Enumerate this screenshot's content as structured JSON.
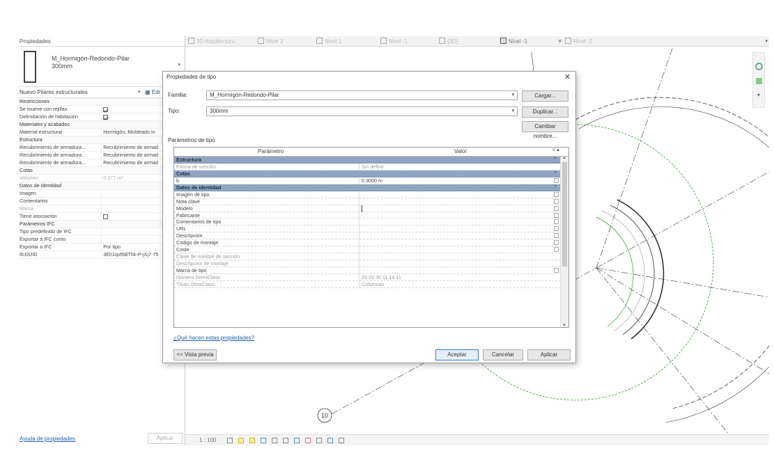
{
  "properties_palette": {
    "title": "Propiedades",
    "type_name": "M_Hormigón-Redondo-Pilar",
    "type_size": "300mm",
    "selector_label": "Nuevo Pilares estructurales",
    "edit_type_label": "Edi",
    "rows": [
      {
        "label": "Restricciones",
        "value": "",
        "kind": "group"
      },
      {
        "label": "Se mueve con rejillas",
        "value": "",
        "kind": "check-on"
      },
      {
        "label": "Delimitación de habitación",
        "value": "",
        "kind": "check-on"
      },
      {
        "label": "Materiales y acabados",
        "value": "",
        "kind": "group"
      },
      {
        "label": "Material estructural",
        "value": "Hormigón, Moldeado in",
        "kind": "row"
      },
      {
        "label": "Estructura",
        "value": "",
        "kind": "group"
      },
      {
        "label": "Recubrimiento de armadura...",
        "value": "Recubrimiento de armad",
        "kind": "row"
      },
      {
        "label": "Recubrimiento de armadura...",
        "value": "Recubrimiento de armad",
        "kind": "row"
      },
      {
        "label": "Recubrimiento de armadura...",
        "value": "Recubrimiento de armad",
        "kind": "row"
      },
      {
        "label": "Cotas",
        "value": "",
        "kind": "group"
      },
      {
        "label": "Volumen",
        "value": "0.177 m³",
        "kind": "dim"
      },
      {
        "label": "Datos de identidad",
        "value": "",
        "kind": "group"
      },
      {
        "label": "Imagen",
        "value": "",
        "kind": "row"
      },
      {
        "label": "Comentarios",
        "value": "",
        "kind": "row"
      },
      {
        "label": "Marca",
        "value": "",
        "kind": "dim"
      },
      {
        "label": "Tiene asociación",
        "value": "",
        "kind": "check-off"
      },
      {
        "label": "Parámetros IFC",
        "value": "",
        "kind": "group"
      },
      {
        "label": "Tipo predefinido de IFC",
        "value": "",
        "kind": "row"
      },
      {
        "label": "Exportar a IFC como",
        "value": "",
        "kind": "row"
      },
      {
        "label": "Exportar a IFC",
        "value": "Por tipo",
        "kind": "row"
      },
      {
        "label": "IfcGUID",
        "value": "3Eh1qvt5BThk-P-jXj7-75",
        "kind": "row"
      }
    ],
    "help_link": "Ayuda de propiedades",
    "apply_label": "Aplicar"
  },
  "view_tabs": {
    "tabs": [
      {
        "label": "3D Arquitectura",
        "active": false
      },
      {
        "label": "Nivel 2",
        "active": false
      },
      {
        "label": "Nivel 1",
        "active": false
      },
      {
        "label": "Nivel -1",
        "active": false
      },
      {
        "label": "{3D}",
        "active": false
      },
      {
        "label": "Nivel -1",
        "active": true
      },
      {
        "label": "Nivel -2",
        "active": false
      }
    ],
    "close_glyph": "×"
  },
  "canvas": {
    "grid_bubble_label": "10",
    "nav_glyph": "▾"
  },
  "view_control_bar": {
    "scale": "1 : 100"
  },
  "dialog": {
    "title": "Propiedades de tipo",
    "family_label": "Familia:",
    "family_value": "M_Hormigón-Redondo-Pilar",
    "type_label": "Tipo:",
    "type_value": "300mm",
    "load_button": "Cargar...",
    "duplicate_button": "Duplicar...",
    "rename_button": "Cambiar nombre...",
    "type_params_label": "Parámetros de tipo",
    "col_parameter": "Parámetro",
    "col_value": "Valor",
    "rows": [
      {
        "label": "Estructura",
        "value": "",
        "kind": "group"
      },
      {
        "label": "Forma de sección",
        "value": "Sin definir",
        "kind": "dim"
      },
      {
        "label": "Cotas",
        "value": "",
        "kind": "group"
      },
      {
        "label": "b",
        "value": "0.3000 m",
        "kind": "row"
      },
      {
        "label": "Datos de identidad",
        "value": "",
        "kind": "group"
      },
      {
        "label": "Imagen de tipo",
        "value": "",
        "kind": "row"
      },
      {
        "label": "Nota clave",
        "value": "",
        "kind": "row"
      },
      {
        "label": "Modelo",
        "value": "",
        "kind": "sel"
      },
      {
        "label": "Fabricante",
        "value": "",
        "kind": "row"
      },
      {
        "label": "Comentarios de tipo",
        "value": "",
        "kind": "row"
      },
      {
        "label": "URL",
        "value": "",
        "kind": "row"
      },
      {
        "label": "Descripción",
        "value": "",
        "kind": "row"
      },
      {
        "label": "Código de montaje",
        "value": "",
        "kind": "row"
      },
      {
        "label": "Coste",
        "value": "",
        "kind": "row"
      },
      {
        "label": "Clave de nombre de sección",
        "value": "",
        "kind": "dim"
      },
      {
        "label": "Descripción de montaje",
        "value": "",
        "kind": "dim"
      },
      {
        "label": "Marca de tipo",
        "value": "",
        "kind": "row"
      },
      {
        "label": "Número OmniClass",
        "value": "23.25.30.11.14.11",
        "kind": "dim"
      },
      {
        "label": "Título OmniClass",
        "value": "Columnas",
        "kind": "dim"
      }
    ],
    "help_link": "¿Qué hacen estas propiedades?",
    "preview_button": "<< Vista previa",
    "ok_button": "Aceptar",
    "cancel_button": "Cancelar",
    "apply_button": "Aplicar"
  }
}
